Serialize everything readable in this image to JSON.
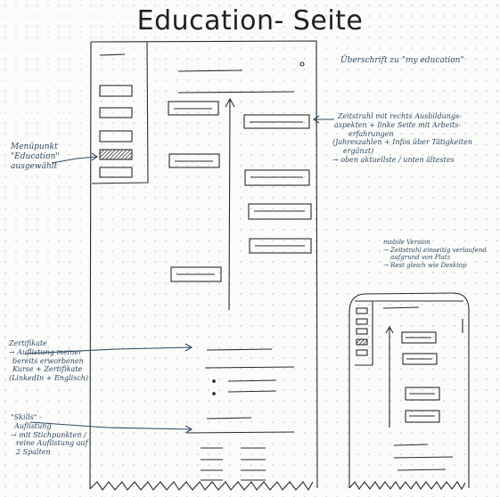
{
  "title": "Education- Seite",
  "annotations": {
    "heading": "Überschrift zu \"my education\"",
    "timeline": [
      "Zeitstrahl mit rechts Ausbildungs-",
      "aspekten + linke Seite mit Arbeits-",
      "erfahrungen",
      "(Jahreszahlen + Infos über Tätigkeiten",
      "ergänzt)",
      "→ oben aktuellste / unten ältestes"
    ],
    "menu": [
      "Menüpunkt",
      "\"Education\"",
      "ausgewählt"
    ],
    "mobile": [
      "mobile Version",
      "→ Zeitstrahl einseitig verlaufend",
      "aufgrund von Platz",
      "→ Rest gleich wie Desktop"
    ],
    "certificates": [
      "Zertifikate",
      "→ Auflistung meiner",
      "bereits erworbenen",
      "Kurse + Zertifikate",
      "(LinkedIn + Englisch)"
    ],
    "skills": [
      "\"Skills\" -",
      "Auflistung",
      "→ mit Stichpunkten /",
      "reine Auflistung auf",
      "2 Spalten"
    ]
  },
  "colors": {
    "ink": "#2b2b2b",
    "note": "#2f4a5e",
    "hatch": "#3a3a3a"
  }
}
